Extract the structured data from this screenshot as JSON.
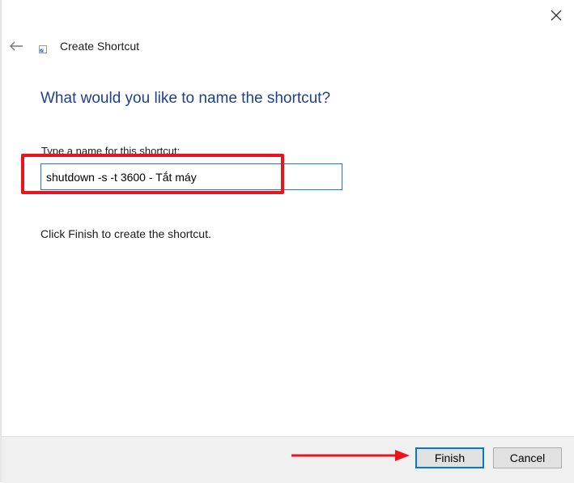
{
  "window": {
    "title": "Create Shortcut",
    "close_icon": "close-icon",
    "back_icon": "back-arrow-icon",
    "app_icon": "shortcut-icon"
  },
  "main": {
    "heading": "What would you like to name the shortcut?",
    "field_label": "Type a name for this shortcut:",
    "name_value": "shutdown -s -t 3600 - Tắt máy",
    "finish_hint": "Click Finish to create the shortcut."
  },
  "footer": {
    "finish_label": "Finish",
    "cancel_label": "Cancel"
  },
  "annotations": {
    "highlight_color": "#e8161c",
    "arrow_color": "#e8161c"
  },
  "colors": {
    "heading": "#1f3f8f",
    "input_border": "#2b78b7",
    "default_button_border": "#0078d7",
    "footer_bg": "#f0f0f0"
  }
}
